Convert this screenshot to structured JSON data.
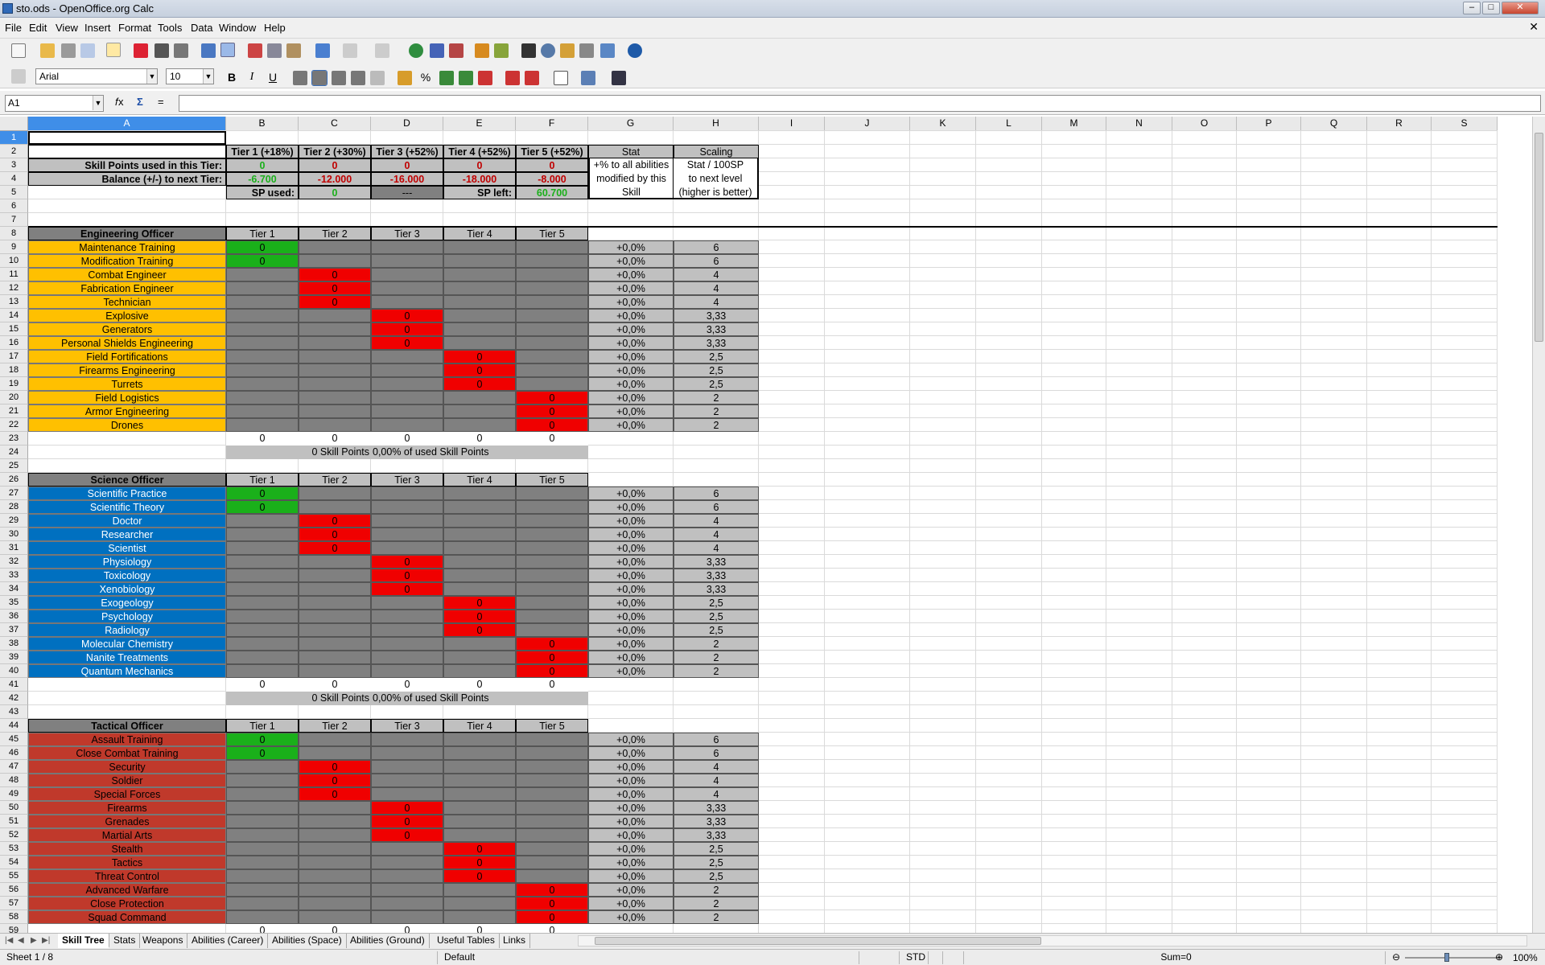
{
  "window": {
    "title": "sto.ods - OpenOffice.org Calc"
  },
  "menu": [
    "File",
    "Edit",
    "View",
    "Insert",
    "Format",
    "Tools",
    "Data",
    "Window",
    "Help"
  ],
  "toolbar": {
    "font_name": "Arial",
    "font_size": "10"
  },
  "formula": {
    "name_box": "A1",
    "content": "",
    "fx": "𝑓x",
    "sum": "Σ",
    "eq": "="
  },
  "columns": [
    "A",
    "B",
    "C",
    "D",
    "E",
    "F",
    "G",
    "H",
    "I",
    "J",
    "K",
    "L",
    "M",
    "N",
    "O",
    "P",
    "Q",
    "R",
    "S"
  ],
  "rows": [
    "1",
    "2",
    "3",
    "4",
    "5",
    "6",
    "7",
    "8",
    "9",
    "10",
    "11",
    "12",
    "13",
    "14",
    "15",
    "16",
    "17",
    "18",
    "19",
    "20",
    "21",
    "22",
    "23",
    "24",
    "25",
    "26",
    "27",
    "28",
    "29",
    "30",
    "31",
    "32",
    "33",
    "34",
    "35",
    "36",
    "37",
    "38",
    "39",
    "40",
    "41",
    "42",
    "43",
    "44",
    "45",
    "46",
    "47",
    "48",
    "49",
    "50",
    "51",
    "52",
    "53",
    "54",
    "55",
    "56",
    "57",
    "58",
    "59"
  ],
  "summary": {
    "tier_headers": [
      "Tier 1 (+18%)",
      "Tier 2 (+30%)",
      "Tier 3 (+52%)",
      "Tier 4 (+52%)",
      "Tier 5 (+52%)"
    ],
    "stat_header": "Stat",
    "scaling_header": "Scaling",
    "used_label": "Skill Points used in this Tier:",
    "used": [
      "0",
      "0",
      "0",
      "0",
      "0"
    ],
    "balance_label": "Balance (+/-) to next Tier:",
    "balance": [
      "-6.700",
      "-12.000",
      "-16.000",
      "-18.000",
      "-8.000"
    ],
    "sp_used_label": "SP used:",
    "sp_used": "0",
    "sp_dash": "---",
    "sp_left_label": "SP left:",
    "sp_left": "60.700",
    "stat_desc": [
      "+% to all abilities",
      "modified by this",
      "Skill"
    ],
    "scaling_desc": [
      "Stat / 100SP",
      "to next level",
      "(higher is better)"
    ]
  },
  "tier_labels": [
    "Tier 1",
    "Tier 2",
    "Tier 3",
    "Tier 4",
    "Tier 5"
  ],
  "sections": [
    {
      "title": "Engineering Officer",
      "skills": [
        "Maintenance Training",
        "Modification Training",
        "Combat Engineer",
        "Fabrication Engineer",
        "Technician",
        "Explosive",
        "Generators",
        "Personal Shields Engineering",
        "Field Fortifications",
        "Firearms Engineering",
        "Turrets",
        "Field Logistics",
        "Armor Engineering",
        "Drones"
      ],
      "totals": [
        "0",
        "0",
        "0",
        "0",
        "0"
      ],
      "sp_total": "0 Skill Points",
      "pct": "0,00% of used Skill Points"
    },
    {
      "title": "Science Officer",
      "skills": [
        "Scientific Practice",
        "Scientific Theory",
        "Doctor",
        "Researcher",
        "Scientist",
        "Physiology",
        "Toxicology",
        "Xenobiology",
        "Exogeology",
        "Psychology",
        "Radiology",
        "Molecular Chemistry",
        "Nanite Treatments",
        "Quantum Mechanics"
      ],
      "totals": [
        "0",
        "0",
        "0",
        "0",
        "0"
      ],
      "sp_total": "0 Skill Points",
      "pct": "0,00% of used Skill Points"
    },
    {
      "title": "Tactical Officer",
      "skills": [
        "Assault Training",
        "Close Combat Training",
        "Security",
        "Soldier",
        "Special Forces",
        "Firearms",
        "Grenades",
        "Martial Arts",
        "Stealth",
        "Tactics",
        "Threat Control",
        "Advanced Warfare",
        "Close Protection",
        "Squad Command"
      ],
      "totals": [
        "0",
        "0",
        "0",
        "0",
        "0"
      ],
      "sp_total": "",
      "pct": ""
    }
  ],
  "skill_value": "0",
  "stat_value": "+0,0%",
  "scaling_values": [
    "6",
    "6",
    "4",
    "4",
    "4",
    "3,33",
    "3,33",
    "3,33",
    "2,5",
    "2,5",
    "2,5",
    "2",
    "2",
    "2"
  ],
  "sheet_tabs": [
    "Skill Tree",
    "Stats",
    "Weapons",
    "Abilities (Career)",
    "Abilities (Space)",
    "Abilities (Ground)",
    "Useful Tables",
    "Links"
  ],
  "status": {
    "sheet": "Sheet 1 / 8",
    "style": "Default",
    "mode": "STD",
    "sum": "Sum=0",
    "zoom": "100%"
  },
  "colors": {
    "engineering": "#ffc000",
    "science": "#0070c0",
    "tactical": "#c0392b",
    "tier_active": "#1ab01a",
    "tier_locked": "#f00000",
    "selection": "#3f8ee8"
  }
}
